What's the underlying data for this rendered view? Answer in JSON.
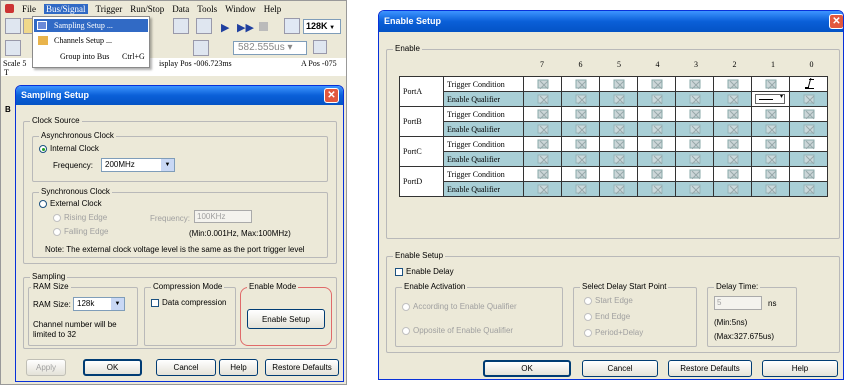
{
  "left_app": {
    "menubar": [
      "File",
      "Bus/Signal",
      "Trigger",
      "Run/Stop",
      "Data",
      "Tools",
      "Window",
      "Help"
    ],
    "context_menu": {
      "items": [
        {
          "label": "Sampling Setup ..."
        },
        {
          "label": "Channels Setup ..."
        },
        {
          "label": "Group into Bus",
          "shortcut": "Ctrl+G"
        }
      ]
    },
    "toolbar": {
      "memory_depth": "128K",
      "time_value": "582.555us"
    },
    "info_strip": {
      "scale_text": "Scale 5",
      "display_pos": "isplay Pos -006.723ms",
      "a_pos": "A Pos -075"
    },
    "side_letters": [
      "T",
      "B"
    ]
  },
  "sampling_setup": {
    "title": "Sampling Setup",
    "clock_source": {
      "legend": "Clock Source",
      "async": {
        "legend": "Asynchronous Clock",
        "internal_label": "Internal Clock",
        "frequency_label": "Frequency:",
        "frequency_value": "200MHz"
      },
      "sync": {
        "legend": "Synchronous Clock",
        "external_label": "External Clock",
        "rising_label": "Rising Edge",
        "falling_label": "Falling Edge",
        "frequency_label": "Frequency:",
        "frequency_value": "100KHz",
        "range_text": "(Min:0.001Hz, Max:100MHz)"
      },
      "note": "Note: The external clock voltage level is the same as the port trigger level"
    },
    "sampling": {
      "legend": "Sampling",
      "ram_size_legend": "RAM Size",
      "ram_size_label": "RAM Size:",
      "ram_size_value": "128k",
      "channel_note_line1": "Channel number will be",
      "channel_note_line2": "limited to 32"
    },
    "compression": {
      "legend": "Compression Mode",
      "checkbox_label": "Data compression"
    },
    "enable_mode": {
      "legend": "Enable Mode",
      "button": "Enable Setup"
    },
    "buttons": {
      "apply": "Apply",
      "ok": "OK",
      "cancel": "Cancel",
      "help": "Help",
      "restore": "Restore Defaults"
    }
  },
  "enable_setup": {
    "title": "Enable Setup",
    "enable_group_legend": "Enable",
    "bit_headers": [
      "7",
      "6",
      "5",
      "4",
      "3",
      "2",
      "1",
      "0"
    ],
    "ports": [
      "PortA",
      "PortB",
      "PortC",
      "PortD"
    ],
    "row_labels": {
      "trigger": "Trigger Condition",
      "qualifier": "Enable Qualifier"
    },
    "setup": {
      "legend": "Enable Setup",
      "delay_checkbox": "Enable Delay",
      "activation": {
        "legend": "Enable Activation",
        "options": [
          "According to Enable Qualifier",
          "Opposite of Enable Qualifier"
        ]
      },
      "delay_start": {
        "legend": "Select Delay Start Point",
        "options": [
          "Start Edge",
          "End Edge",
          "Period+Delay"
        ]
      },
      "delay_time": {
        "legend": "Delay Time:",
        "value": "5",
        "unit": "ns",
        "min": "(Min:5ns)",
        "max": "(Max:327.675us)"
      }
    },
    "buttons": {
      "ok": "OK",
      "cancel": "Cancel",
      "restore": "Restore Defaults",
      "help": "Help"
    }
  }
}
